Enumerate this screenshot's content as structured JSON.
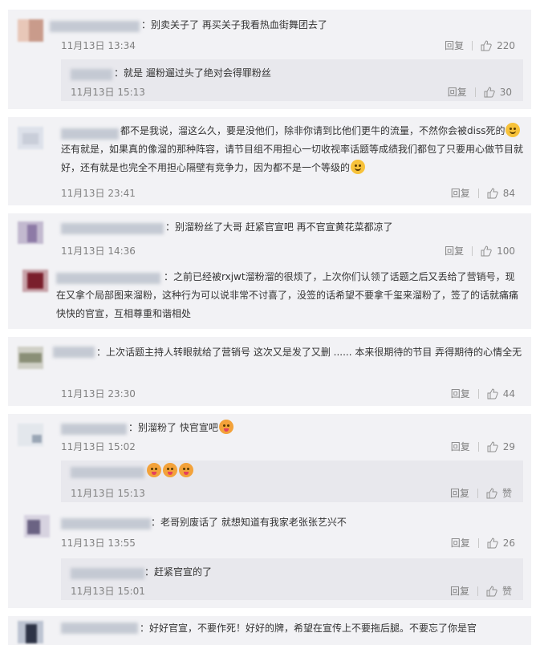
{
  "comments": [
    {
      "text": "：别卖关子了 再买关子我看热血街舞团去了",
      "time": "11月13日 13:34",
      "reply": "回复",
      "likes": "220",
      "sub": {
        "text": "：就是 遛粉遛过头了绝对会得罪粉丝",
        "time": "11月13日 15:13",
        "reply": "回复",
        "likes": "30"
      }
    },
    {
      "text_a": "都不是我说，溜这么久，要是没他们，除非你请到比他们更牛的流量，不然你会被diss死的",
      "text_b": "还有就是，如果真的像溜的那种阵容，请节目组不用担心一切收视率话题等成绩我们都包了只要用心做节目就好，还有就是也完全不用担心隔壁有竞争力，因为都不是一个等级的",
      "time": "11月13日 23:41",
      "reply": "回复",
      "likes": "84"
    },
    {
      "text": "：别溜粉丝了大哥 赶紧官宣吧 再不官宣黄花菜都凉了",
      "time": "11月13日 14:36",
      "reply": "回复",
      "likes": "100",
      "sub": {
        "text": "：之前已经被rxjwt溜粉溜的很烦了，上次你们认领了话题之后又丢给了营销号，现在又拿个局部图来溜粉，这种行为可以说非常不讨喜了，没签的话希望不要拿千玺来溜粉了，签了的话就痛痛快快的官宣，互相尊重和谐相处"
      }
    },
    {
      "text": "：上次话题主持人转眼就给了营销号 这次又是发了又删 ...... 本来很期待的节目 弄得期待的心情全无",
      "time": "11月13日 23:30",
      "reply": "回复",
      "likes": "44"
    },
    {
      "text": "：别溜粉了 快官宣吧",
      "time": "11月13日 15:02",
      "reply": "回复",
      "likes": "29",
      "sub": {
        "time": "11月13日 15:13",
        "reply": "回复",
        "likes": "赞"
      }
    },
    {
      "text": "：老哥别废话了 就想知道有我家老张张艺兴不",
      "time": "11月13日 13:55",
      "reply": "回复",
      "likes": "26",
      "sub": {
        "text": "：赶紧官宣的了",
        "time": "11月13日 15:01",
        "reply": "回复",
        "likes": "赞"
      }
    },
    {
      "text": "：好好官宣，不要作死！好好的牌，希望在宣传上不要拖后腿。不要忘了你是官"
    }
  ],
  "icons": {
    "like": "thumb-up-icon",
    "emoji_smile": "smile-emoji-icon",
    "emoji_tongue": "tongue-emoji-icon"
  },
  "colors": {
    "card_bg": "#f2f2f5",
    "sub_bg": "#e8e8ed",
    "meta": "#808080"
  }
}
